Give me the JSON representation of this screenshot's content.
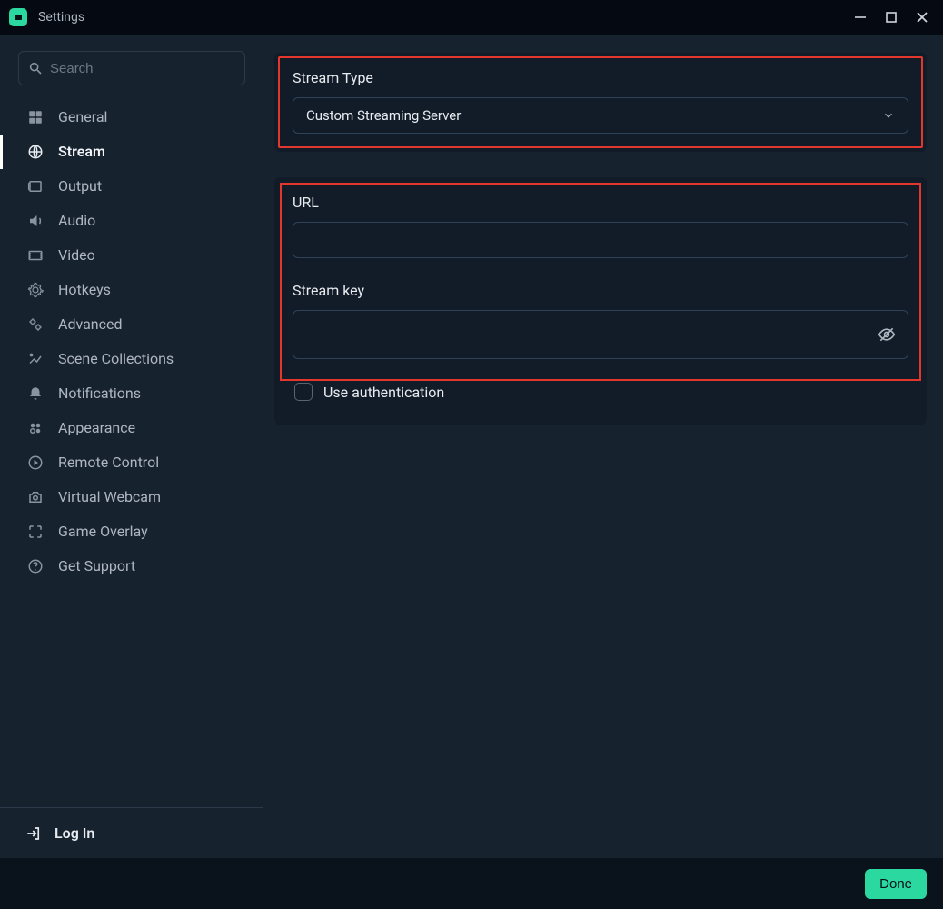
{
  "titlebar": {
    "title": "Settings"
  },
  "search": {
    "placeholder": "Search"
  },
  "sidebar": {
    "items": [
      "General",
      "Stream",
      "Output",
      "Audio",
      "Video",
      "Hotkeys",
      "Advanced",
      "Scene Collections",
      "Notifications",
      "Appearance",
      "Remote Control",
      "Virtual Webcam",
      "Game Overlay",
      "Get Support"
    ],
    "login": "Log In"
  },
  "stream_panel": {
    "type_label": "Stream Type",
    "type_value": "Custom Streaming Server"
  },
  "url_panel": {
    "url_label": "URL",
    "url_value": "",
    "key_label": "Stream key",
    "key_value": "",
    "auth_label": "Use authentication"
  },
  "footer": {
    "done": "Done"
  }
}
